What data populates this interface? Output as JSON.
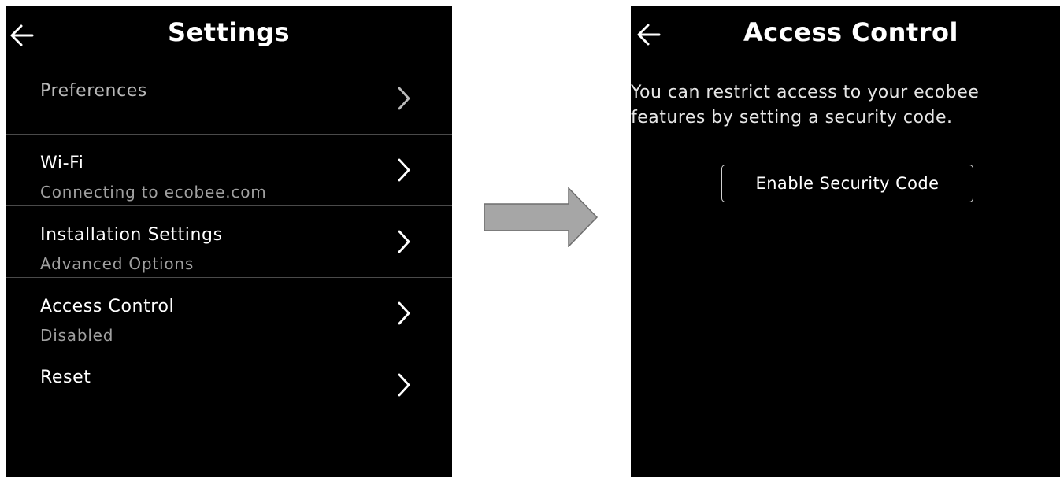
{
  "settings_screen": {
    "title": "Settings",
    "items": [
      {
        "label": "Preferences",
        "sub": ""
      },
      {
        "label": "Wi-Fi",
        "sub": "Connecting to ecobee.com"
      },
      {
        "label": "Installation Settings",
        "sub": "Advanced Options"
      },
      {
        "label": "Access Control",
        "sub": "Disabled"
      },
      {
        "label": "Reset",
        "sub": ""
      }
    ]
  },
  "access_control_screen": {
    "title": "Access Control",
    "description_lines": [
      "You can restrict access to your ecobee",
      "features by setting a security code."
    ],
    "enable_button_label": "Enable Security Code"
  },
  "icons": {
    "back": "back-arrow-icon",
    "chevron": "chevron-right-icon",
    "transition": "right-arrow-icon"
  },
  "colors": {
    "screen_bg": "#000000",
    "text": "#ffffff",
    "subtext": "#a0a0a0",
    "divider": "#4a4a4a",
    "transition_arrow_fill": "#a6a6a6"
  }
}
